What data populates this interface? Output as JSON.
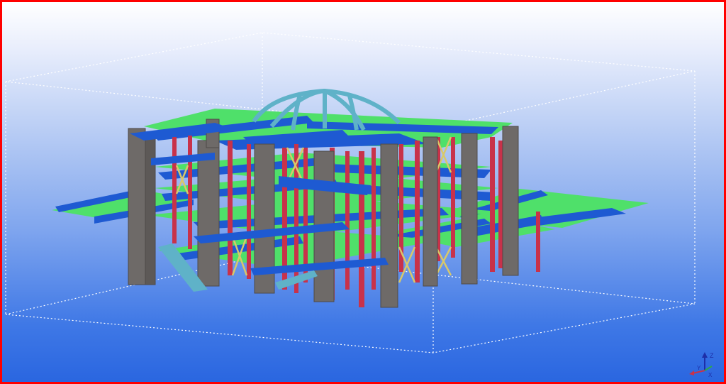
{
  "view": {
    "colors": {
      "frame": "#ff0000",
      "columns": "#6e6a68",
      "steel_posts": "#c8324a",
      "beams": "#1e5ad2",
      "decks": "#4fe06a",
      "braces": "#d8c86a",
      "truss": "#5fb2c8"
    }
  },
  "axis": {
    "x": "X",
    "y": "Y",
    "z": "Z"
  }
}
